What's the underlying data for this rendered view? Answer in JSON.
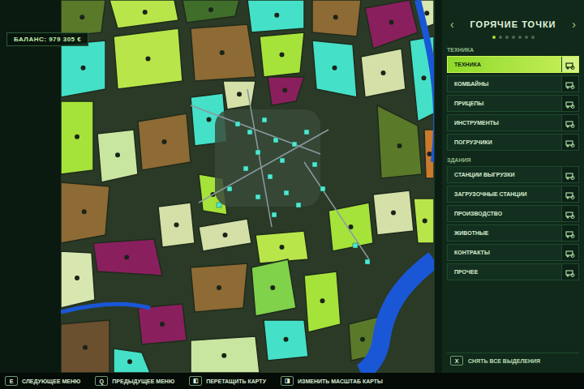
{
  "balance": "БАЛАНС: 979 305 €",
  "panel": {
    "title": "ГОРЯЧИЕ ТОЧКИ",
    "prev": "‹",
    "next": "›",
    "page_dots": [
      {
        "selected": true
      },
      {
        "selected": false
      },
      {
        "selected": false
      },
      {
        "selected": false
      },
      {
        "selected": false
      },
      {
        "selected": false
      },
      {
        "selected": false
      }
    ],
    "sections": [
      {
        "heading": "ТЕХНИКА",
        "items": [
          {
            "label": "ТЕХНИКА",
            "selected": true
          },
          {
            "label": "КОМБАЙНЫ",
            "selected": false
          },
          {
            "label": "ПРИЦЕПЫ",
            "selected": false
          },
          {
            "label": "ИНСТРУМЕНТЫ",
            "selected": false
          },
          {
            "label": "ПОГРУЗЧИКИ",
            "selected": false
          }
        ]
      },
      {
        "heading": "ЗДАНИЯ",
        "items": [
          {
            "label": "СТАНЦИИ ВЫГРУЗКИ",
            "selected": false
          },
          {
            "label": "ЗАГРУЗОЧНЫЕ СТАНЦИИ",
            "selected": false
          },
          {
            "label": "ПРОИЗВОДСТВО",
            "selected": false
          },
          {
            "label": "ЖИВОТНЫЕ",
            "selected": false
          },
          {
            "label": "КОНТРАКТЫ",
            "selected": false
          },
          {
            "label": "ПРОЧЕЕ",
            "selected": false
          }
        ]
      }
    ],
    "clear": "СНЯТЬ ВСЕ ВЫДЕЛЕНИЯ",
    "clear_key": "X"
  },
  "fields": [
    {
      "color": "#5a7a2a"
    },
    {
      "color": "#b8e64a"
    },
    {
      "color": "#3f6e2a"
    },
    {
      "color": "#45e0c8"
    },
    {
      "color": "#8e6a34"
    },
    {
      "color": "#8a1f5e"
    },
    {
      "color": "#d8e6b0"
    },
    {
      "color": "#45e0c8"
    },
    {
      "color": "#b8e64a"
    },
    {
      "color": "#8e6a34"
    },
    {
      "color": "#a6e33a"
    },
    {
      "color": "#45e0c8"
    },
    {
      "color": "#d4e0a8"
    },
    {
      "color": "#45e0c8"
    },
    {
      "color": "#d4e0a8"
    },
    {
      "color": "#8a1f5e"
    },
    {
      "color": "#a6e33a"
    },
    {
      "color": "#c9e6a0"
    },
    {
      "color": "#8e6a34"
    },
    {
      "color": "#45e0c8"
    },
    {
      "color": "#5a7a2a"
    },
    {
      "color": "#c97a2c"
    },
    {
      "color": "#8e6a34"
    },
    {
      "color": "#8a1f5e"
    },
    {
      "color": "#d4e0a8"
    },
    {
      "color": "#a6e33a"
    },
    {
      "color": "#d4e0a8"
    },
    {
      "color": "#b8e64a"
    },
    {
      "color": "#a6e33a"
    },
    {
      "color": "#d4e0a8"
    },
    {
      "color": "#b8e64a"
    },
    {
      "color": "#d8e6b0"
    },
    {
      "color": "#8a1f5e"
    },
    {
      "color": "#8e6a34"
    },
    {
      "color": "#7fd24a"
    },
    {
      "color": "#45e0c8"
    },
    {
      "color": "#a6e33a"
    },
    {
      "color": "#c9e6a0"
    },
    {
      "color": "#6b5030"
    },
    {
      "color": "#45e0c8"
    },
    {
      "color": "#5a7a2a"
    }
  ],
  "controls": [
    {
      "key": "E",
      "label": "СЛЕДУЮЩЕЕ МЕНЮ"
    },
    {
      "key": "Q",
      "label": "ПРЕДЫДУЩЕЕ МЕНЮ"
    },
    {
      "key": "◧",
      "label": "ПЕРЕТАЩИТЬ КАРТУ"
    },
    {
      "key": "◨",
      "label": "ИЗМЕНИТЬ МАСШТАБ КАРТЫ"
    }
  ]
}
